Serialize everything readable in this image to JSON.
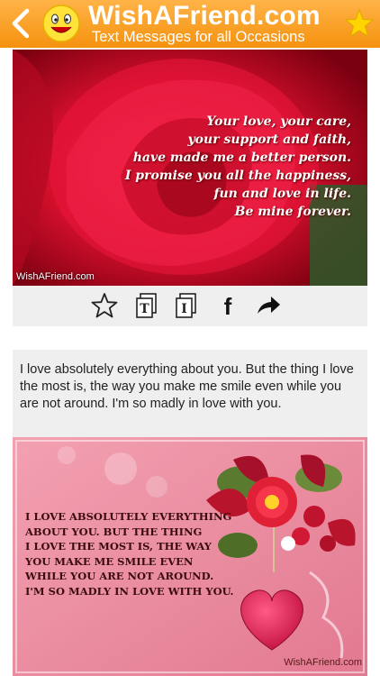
{
  "header": {
    "back_icon": "chevron-left-icon",
    "logo_icon": "smiley-face-icon",
    "brand": "WishAFriend.com",
    "tagline": "Text Messages for all Occasions",
    "favorite_icon": "star-icon",
    "colors": {
      "bar": "#f5920f",
      "star": "#ffd400"
    }
  },
  "card1": {
    "poem_lines": [
      "Your love, your care,",
      "your support and faith,",
      "have made me a better person.",
      "I promise you all the happiness,",
      "fun and love in life.",
      "Be mine forever."
    ],
    "watermark": "WishAFriend.com",
    "actions": [
      {
        "name": "favorite-star-icon"
      },
      {
        "name": "text-copy-icon",
        "letter": "T"
      },
      {
        "name": "image-copy-icon",
        "letter": "I"
      },
      {
        "name": "facebook-icon",
        "letter": "f"
      },
      {
        "name": "share-arrow-icon"
      }
    ]
  },
  "card2": {
    "message": "I love absolutely everything about you. But the thing I love the most is, the way you make me smile even while you are not around. I'm so madly in love with you.",
    "image_lines": [
      "I love absolutely everything",
      "about you. But the thing",
      "I love the most is, the way",
      "you make me smile even",
      "while you are not around.",
      "I'm so madly in love with you."
    ],
    "watermark": "WishAFriend.com"
  }
}
